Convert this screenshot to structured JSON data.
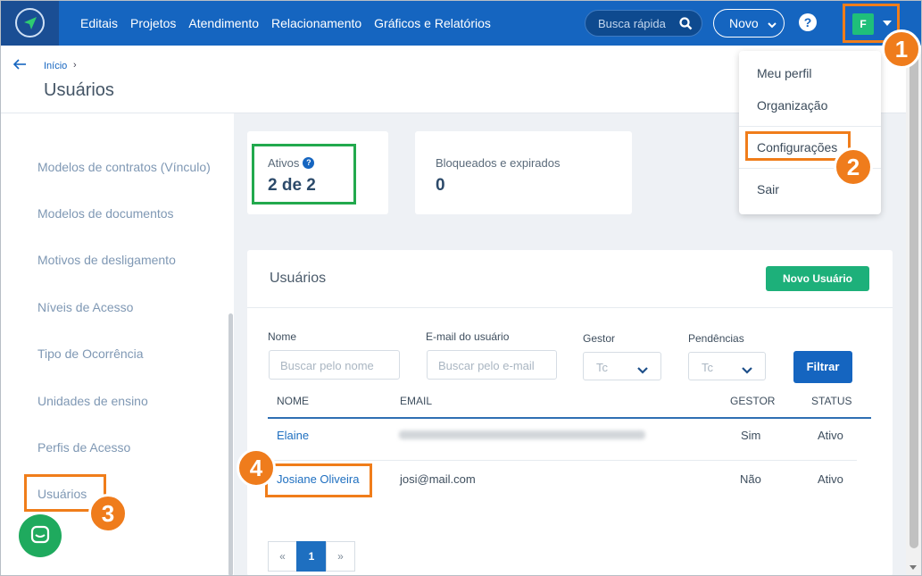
{
  "nav": {
    "items": [
      "Editais",
      "Projetos",
      "Atendimento",
      "Relacionamento",
      "Gráficos e Relatórios"
    ],
    "search_placeholder": "Busca rápida",
    "new_label": "Novo",
    "help_label": "?",
    "avatar_initial": "F"
  },
  "header": {
    "breadcrumb": "Início",
    "breadcrumb_sep": "›",
    "title": "Usuários"
  },
  "sidebar": {
    "items": [
      "Modelos de contratos (Vínculo)",
      "Modelos de documentos",
      "Motivos de desligamento",
      "Níveis de Acesso",
      "Tipo de Ocorrência",
      "Unidades de ensino",
      "Perfis de Acesso",
      "Usuários"
    ]
  },
  "stats": {
    "active_label": "Ativos",
    "active_value": "2 de 2",
    "blocked_label": "Bloqueados e expirados",
    "blocked_value": "0"
  },
  "panel": {
    "title": "Usuários",
    "new_user_label": "Novo Usuário",
    "filters": {
      "name_label": "Nome",
      "name_placeholder": "Buscar pelo nome",
      "email_label": "E-mail do usuário",
      "email_placeholder": "Buscar pelo e-mail",
      "manager_label": "Gestor",
      "manager_value": "Tc",
      "pending_label": "Pendências",
      "pending_value": "Tc",
      "filter_button": "Filtrar"
    },
    "columns": [
      "NOME",
      "EMAIL",
      "GESTOR",
      "STATUS"
    ],
    "rows": [
      {
        "name": "Elaine",
        "email": "",
        "manager": "Sim",
        "status": "Ativo"
      },
      {
        "name": "Josiane Oliveira",
        "email": "josi@mail.com",
        "manager": "Não",
        "status": "Ativo"
      }
    ],
    "pagination": [
      "«",
      "1",
      "»"
    ]
  },
  "user_menu": {
    "items": [
      "Meu perfil",
      "Organização",
      "Configurações",
      "Sair"
    ]
  },
  "annotations": [
    "1",
    "2",
    "3",
    "4"
  ],
  "colors": {
    "primary": "#1565c0",
    "highlight_orange": "#f07d1a",
    "highlight_green": "#22a94d",
    "success": "#1db07a"
  }
}
